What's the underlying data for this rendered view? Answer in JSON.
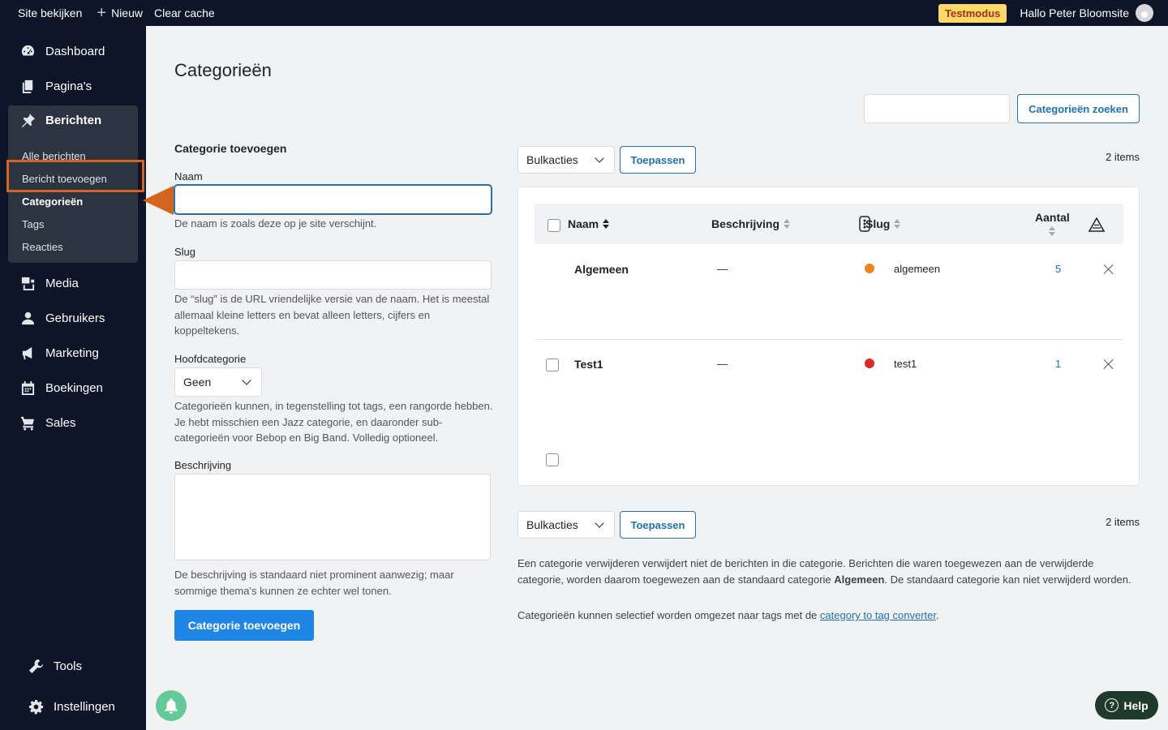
{
  "topbar": {
    "site_label": "Site bekijken",
    "new_label": "Nieuw",
    "cache_label": "Clear cache",
    "testmode_label": "Testmodus",
    "greeting": "Hallo Peter Bloomsite"
  },
  "sidebar": {
    "dashboard": "Dashboard",
    "pages": "Pagina's",
    "posts": "Berichten",
    "posts_sub": {
      "all": "Alle berichten",
      "add": "Bericht toevoegen",
      "categories": "Categorieën",
      "tags": "Tags",
      "comments": "Reacties"
    },
    "media": "Media",
    "users": "Gebruikers",
    "marketing": "Marketing",
    "bookings": "Boekingen",
    "sales": "Sales",
    "tools": "Tools",
    "settings": "Instellingen"
  },
  "page": {
    "title": "Categorieën",
    "search_button": "Categorieën zoeken"
  },
  "form": {
    "heading": "Categorie toevoegen",
    "name_label": "Naam",
    "name_help": "De naam is zoals deze op je site verschijnt.",
    "slug_label": "Slug",
    "slug_help": "De “slug” is de URL vriendelijke versie van de naam. Het is meestal allemaal kleine letters en bevat alleen letters, cijfers en koppeltekens.",
    "parent_label": "Hoofdcategorie",
    "parent_value": "Geen",
    "parent_help": "Categorieën kunnen, in tegenstelling tot tags, een rangorde hebben. Je hebt misschien een Jazz categorie, en daaronder sub-categorieën voor Bebop en Big Band. Volledig optioneel.",
    "desc_label": "Beschrijving",
    "desc_help": "De beschrijving is standaard niet prominent aanwezig; maar sommige thema's kunnen ze echter wel tonen.",
    "submit": "Categorie toevoegen"
  },
  "table": {
    "bulk_label": "Bulkacties",
    "apply_label": "Toepassen",
    "items_count": "2 items",
    "columns": {
      "name": "Naam",
      "description": "Beschrijving",
      "slug": "Slug",
      "count": "Aantal"
    },
    "rows": [
      {
        "name": "Algemeen",
        "description": "—",
        "color": "#f0821e",
        "slug": "algemeen",
        "count": "5"
      },
      {
        "name": "Test1",
        "description": "—",
        "color": "#e0262a",
        "slug": "test1",
        "count": "1"
      }
    ]
  },
  "notes": {
    "note1_a": "Een categorie verwijderen verwijdert niet de berichten in die categorie. Berichten die waren toegewezen aan de verwijderde categorie, worden daarom toegewezen aan de standaard categorie ",
    "note1_bold": "Algemeen",
    "note1_b": ". De standaard categorie kan niet verwijderd worden.",
    "note2_a": "Categorieën kunnen selectief worden omgezet naar tags met de ",
    "note2_link": "category to tag converter",
    "note2_b": "."
  },
  "help_label": "Help"
}
